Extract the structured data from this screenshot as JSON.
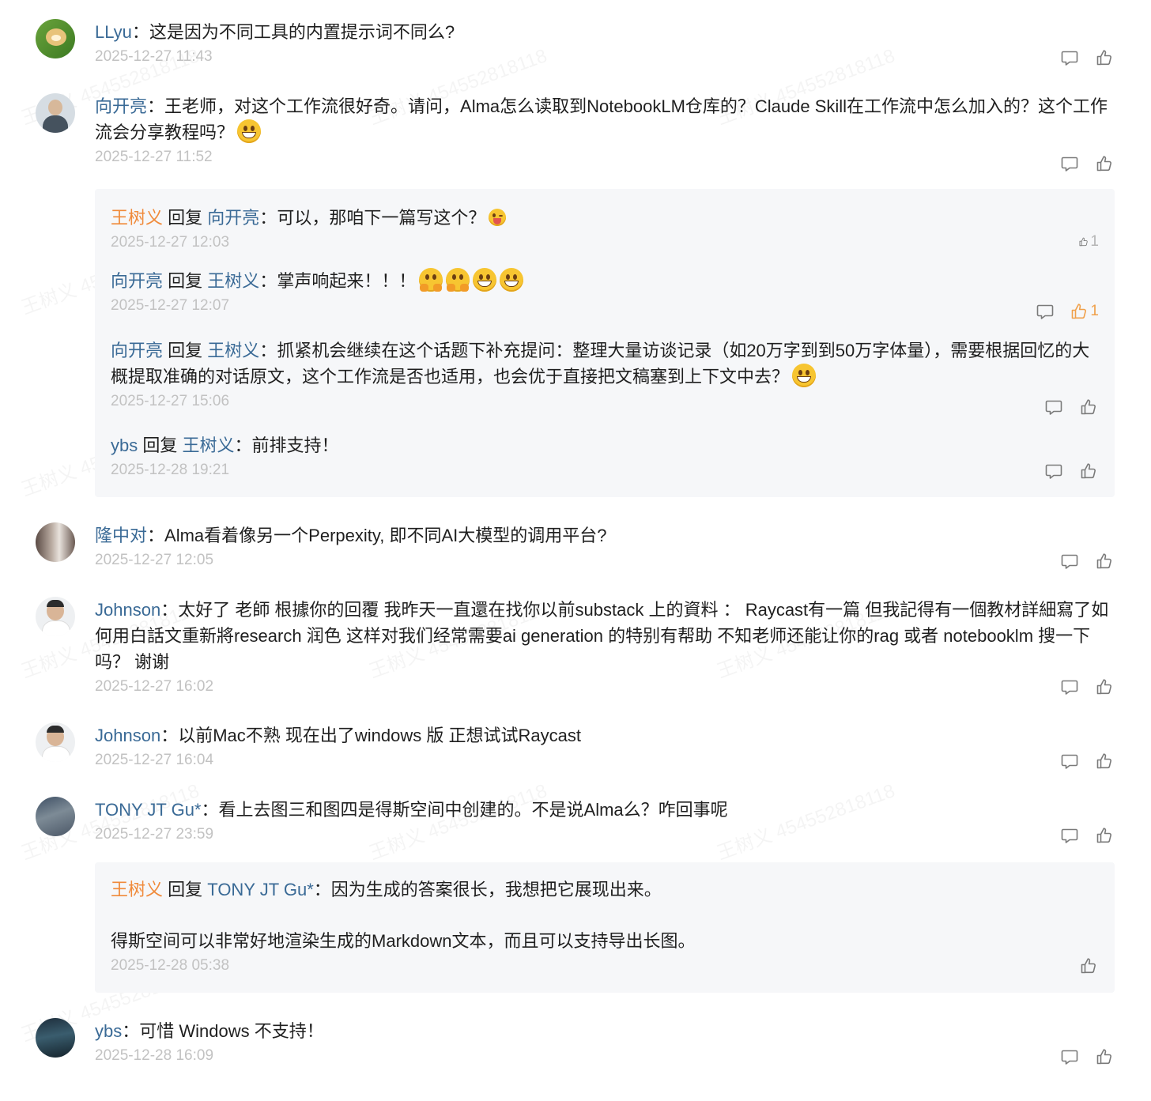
{
  "watermark_text": "王树义 454552818118",
  "colors": {
    "name_blue": "#3a6a96",
    "author_orange": "#f08a3a",
    "time_gray": "#c2c2c2",
    "reply_bg": "#f6f7f9",
    "active_like": "#f0a04a"
  },
  "common": {
    "colon": "：",
    "reply_word": "回复"
  },
  "comments": [
    {
      "user": "LLyu",
      "text": "这是因为不同工具的内置提示词不同么?",
      "time": "2025-12-27 11:43",
      "avatar_icon": "dog-avatar"
    },
    {
      "user": "向开亮",
      "text": "王老师，对这个工作流很好奇。请问，Alma怎么读取到NotebookLM仓库的？Claude Skill在工作流中怎么加入的？这个工作流会分享教程吗？",
      "emoji": "grin-emoji",
      "time": "2025-12-27 11:52",
      "avatar_icon": "man-avatar",
      "replies": [
        {
          "user": "王树义",
          "to": "向开亮",
          "text": "可以，那咱下一篇写这个？",
          "emoji": "winking-tongue-emoji",
          "time": "2025-12-27 12:03",
          "likes": "1"
        },
        {
          "user": "向开亮",
          "to": "王树义",
          "text": "掌声响起来！！！",
          "emoji": "hug-hug-grin-grin",
          "time": "2025-12-27 12:07",
          "likes": "1"
        },
        {
          "user": "向开亮",
          "to": "王树义",
          "text": "抓紧机会继续在这个话题下补充提问：整理大量访谈记录（如20万字到到50万字体量），需要根据回忆的大概提取准确的对话原文，这个工作流是否也适用，也会优于直接把文稿塞到上下文中去？",
          "emoji": "grin-emoji",
          "time": "2025-12-27 15:06"
        },
        {
          "user": "ybs",
          "to": "王树义",
          "text": "前排支持！",
          "time": "2025-12-28 19:21"
        }
      ]
    },
    {
      "user": "隆中对",
      "text": "Alma看着像另一个Perpexity, 即不同AI大模型的调用平台?",
      "time": "2025-12-27 12:05",
      "avatar_icon": "figure-avatar"
    },
    {
      "user": "Johnson",
      "text": "太好了 老師 根據你的回覆 我昨天一直還在找你以前substack 上的資料 ： Raycast有一篇 但我記得有一個教材詳細寫了如何用白話文重新將research 润色 这样对我们经常需要ai generation 的特别有帮助 不知老师还能让你的rag 或者 notebooklm 搜一下吗？  谢谢",
      "time": "2025-12-27 16:02",
      "avatar_icon": "johnson-avatar"
    },
    {
      "user": "Johnson",
      "text": "以前Mac不熟 现在出了windows 版 正想试试Raycast",
      "time": "2025-12-27 16:04",
      "avatar_icon": "johnson-avatar"
    },
    {
      "user": "TONY JT Gu*",
      "text": "看上去图三和图四是得斯空间中创建的。不是说Alma么？咋回事呢",
      "time": "2025-12-27 23:59",
      "avatar_icon": "street-avatar",
      "replies": [
        {
          "user": "王树义",
          "to": "TONY JT Gu*",
          "text": "因为生成的答案很长，我想把它展现出来。",
          "text2": "得斯空间可以非常好地渲染生成的Markdown文本，而且可以支持导出长图。",
          "time": "2025-12-28 05:38"
        }
      ]
    },
    {
      "user": "ybs",
      "text": "可惜 Windows 不支持！",
      "time": "2025-12-28 16:09",
      "avatar_icon": "city-avatar"
    }
  ]
}
